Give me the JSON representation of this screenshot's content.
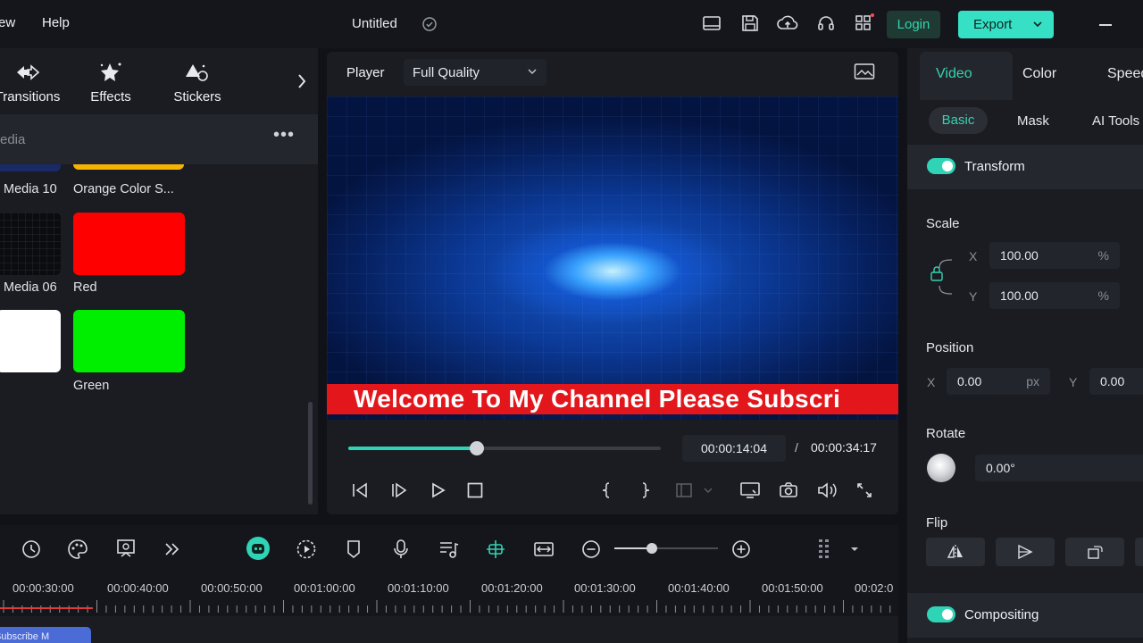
{
  "topbar": {
    "menu": [
      "ew",
      "Help"
    ],
    "title": "Untitled",
    "login_label": "Login",
    "export_label": "Export",
    "icons": [
      "layout-icon",
      "save-icon",
      "cloud-upload-icon",
      "headset-icon",
      "apps-icon"
    ]
  },
  "library": {
    "tabs": [
      {
        "label": "Transitions",
        "icon": "transitions-icon"
      },
      {
        "label": "Effects",
        "icon": "effects-icon"
      },
      {
        "label": "Stickers",
        "icon": "stickers-icon"
      }
    ],
    "header_label": "edia",
    "items": [
      {
        "label": "Media 10",
        "color": "#1a2a66"
      },
      {
        "label": "Orange Color S...",
        "color": "#f5b400"
      },
      {
        "label": "Media 06",
        "color": "#0b0c0f"
      },
      {
        "label": "Red",
        "color": "#ff0000"
      },
      {
        "label": "",
        "color": "#ffffff"
      },
      {
        "label": "Green",
        "color": "#00ee00"
      }
    ]
  },
  "player": {
    "label": "Player",
    "quality": "Full Quality",
    "banner_text": "Welcome To My Channel Please Subscri",
    "progress": 0.412,
    "current_time": "00:00:14:04",
    "separator": "/",
    "total_time": "00:00:34:17"
  },
  "inspector": {
    "tabs": [
      "Video",
      "Color",
      "Speed"
    ],
    "subtabs": [
      "Basic",
      "Mask",
      "AI Tools"
    ],
    "transform": {
      "label": "Transform",
      "enabled": true,
      "scale_label": "Scale",
      "scale_x": "100.00",
      "scale_y": "100.00",
      "scale_unit": "%",
      "position_label": "Position",
      "pos_x": "0.00",
      "pos_y": "0.00",
      "pos_unit": "px",
      "rotate_label": "Rotate",
      "rotate_value": "0.00°",
      "flip_label": "Flip",
      "axis_x": "X",
      "axis_y": "Y"
    },
    "compositing": {
      "label": "Compositing",
      "enabled": true
    }
  },
  "timeline": {
    "zoom_level": 0.36,
    "ruler": [
      "00:00:30:00",
      "00:00:40:00",
      "00:00:50:00",
      "00:01:00:00",
      "00:01:10:00",
      "00:01:20:00",
      "00:01:30:00",
      "00:01:40:00",
      "00:01:50:00",
      "00:02:0"
    ],
    "clip_label": "Subscribe M"
  },
  "colors": {
    "accent": "#2fd4b6",
    "export": "#36e0c5",
    "banner": "#e3161b"
  }
}
